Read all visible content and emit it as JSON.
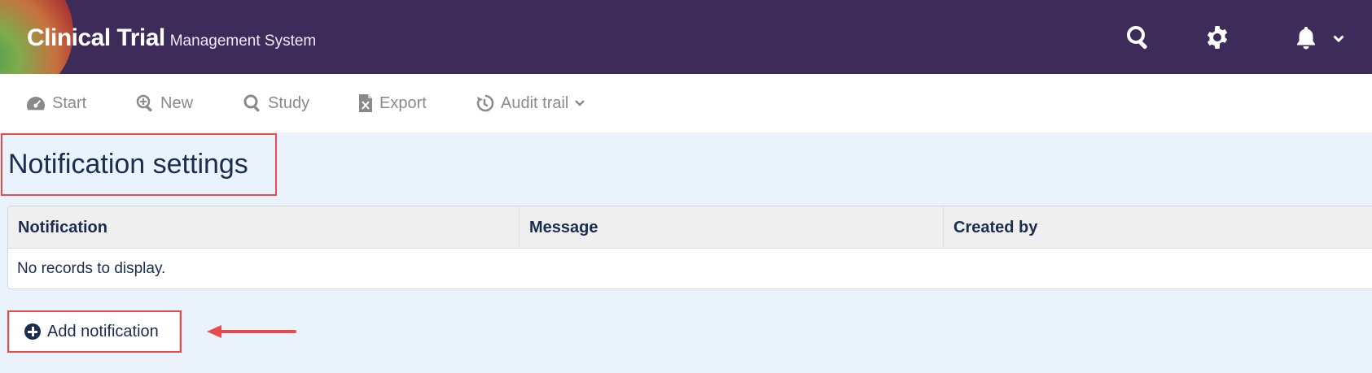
{
  "header": {
    "brand_main": "Clinical Trial",
    "brand_sub": "Management System",
    "icons": [
      "search-icon",
      "gear-icon",
      "bell-icon",
      "chevron-down-icon"
    ]
  },
  "toolbar": {
    "items": [
      {
        "label": "Start",
        "icon": "gauge-icon"
      },
      {
        "label": "New",
        "icon": "zoom-plus-icon"
      },
      {
        "label": "Study",
        "icon": "search-icon"
      },
      {
        "label": "Export",
        "icon": "excel-file-icon"
      },
      {
        "label": "Audit trail",
        "icon": "history-icon"
      }
    ]
  },
  "page": {
    "title": "Notification settings"
  },
  "table": {
    "columns": [
      "Notification",
      "Message",
      "Created by"
    ],
    "empty_text": "No records to display."
  },
  "actions": {
    "add_label": "Add notification"
  },
  "colors": {
    "header_bg": "#3d2b5a",
    "content_bg": "#eaf3fb",
    "text_dark": "#1b2d4f",
    "highlight": "#e84b4b"
  }
}
